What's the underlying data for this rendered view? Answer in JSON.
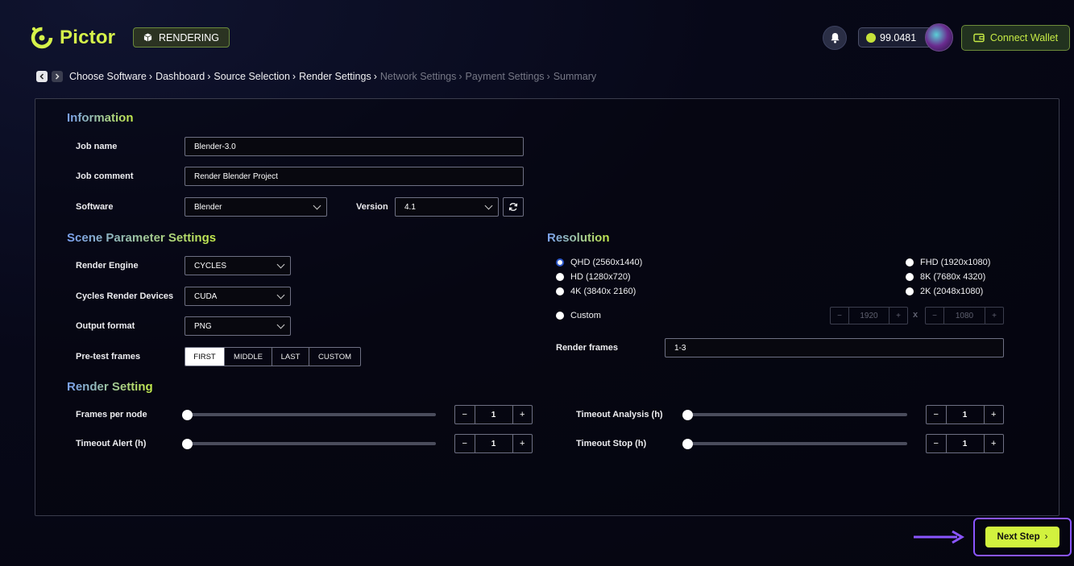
{
  "header": {
    "logo_text": "Pictor",
    "mode_badge": "RENDERING",
    "balance": "99.0481",
    "connect_wallet": "Connect Wallet"
  },
  "breadcrumb": [
    {
      "label": "Choose Software",
      "active": true
    },
    {
      "label": "Dashboard",
      "active": true
    },
    {
      "label": "Source Selection",
      "active": true
    },
    {
      "label": "Render Settings",
      "active": true
    },
    {
      "label": "Network Settings",
      "active": false
    },
    {
      "label": "Payment Settings",
      "active": false
    },
    {
      "label": "Summary",
      "active": false
    }
  ],
  "information": {
    "title": "Information",
    "job_name_label": "Job name",
    "job_name_value": "Blender-3.0",
    "job_comment_label": "Job comment",
    "job_comment_value": "Render Blender Project",
    "software_label": "Software",
    "software_value": "Blender",
    "version_label": "Version",
    "version_value": "4.1"
  },
  "scene": {
    "title": "Scene Parameter Settings",
    "render_engine_label": "Render Engine",
    "render_engine_value": "CYCLES",
    "devices_label": "Cycles Render Devices",
    "devices_value": "CUDA",
    "output_label": "Output format",
    "output_value": "PNG",
    "pretest_label": "Pre-test frames",
    "pretest_options": [
      "FIRST",
      "MIDDLE",
      "LAST",
      "CUSTOM"
    ],
    "pretest_selected": "FIRST"
  },
  "resolution": {
    "title": "Resolution",
    "options": [
      "QHD (2560x1440)",
      "HD (1280x720)",
      "4K (3840x 2160)",
      "FHD (1920x1080)",
      "8K (7680x 4320)",
      "2K (2048x1080)"
    ],
    "selected": "QHD (2560x1440)",
    "custom_label": "Custom",
    "custom_width": "1920",
    "custom_height": "1080",
    "times": "x",
    "render_frames_label": "Render frames",
    "render_frames_value": "1-3"
  },
  "render_setting": {
    "title": "Render Setting",
    "frames_per_node_label": "Frames per node",
    "frames_per_node_value": "1",
    "timeout_alert_label": "Timeout Alert (h)",
    "timeout_alert_value": "1",
    "timeout_analysis_label": "Timeout Analysis (h)",
    "timeout_analysis_value": "1",
    "timeout_stop_label": "Timeout Stop (h)",
    "timeout_stop_value": "1",
    "slider_level": 0
  },
  "footer": {
    "next_step": "Next Step"
  },
  "colors": {
    "accent": "#d2f23e",
    "highlight_border": "#8a55ff",
    "radio_selected": "#2c57c9"
  },
  "icons": [
    "logo-icon",
    "cube-icon",
    "bell-icon",
    "coin-icon",
    "wallet-icon",
    "chevron-left-icon",
    "chevron-right-icon",
    "refresh-icon",
    "arrow-right-icon"
  ]
}
